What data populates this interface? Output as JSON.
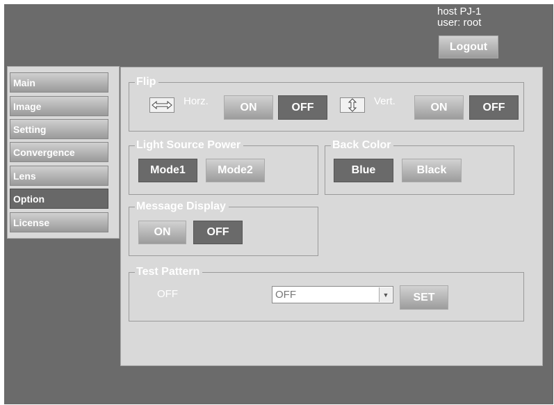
{
  "header": {
    "host": "host PJ-1",
    "user": "user: root",
    "logout_label": "Logout"
  },
  "sidebar": {
    "items": [
      {
        "label": "Main",
        "active": false
      },
      {
        "label": "Image",
        "active": false
      },
      {
        "label": "Setting",
        "active": false
      },
      {
        "label": "Convergence",
        "active": false
      },
      {
        "label": "Lens",
        "active": false
      },
      {
        "label": "Option",
        "active": true
      },
      {
        "label": "License",
        "active": false
      }
    ]
  },
  "flip": {
    "title": "Flip",
    "horz_label": "Horz.",
    "horz_on": "ON",
    "horz_off": "OFF",
    "horz_selected": "OFF",
    "vert_label": "Vert.",
    "vert_on": "ON",
    "vert_off": "OFF",
    "vert_selected": "OFF"
  },
  "light_source": {
    "title": "Light Source  Power",
    "mode1": "Mode1",
    "mode2": "Mode2",
    "selected": "Mode1"
  },
  "back_color": {
    "title": "Back Color",
    "blue": "Blue",
    "black": "Black",
    "selected": "Blue"
  },
  "message_display": {
    "title": "Message Display",
    "on": "ON",
    "off": "OFF",
    "selected": "OFF"
  },
  "test_pattern": {
    "title": "Test Pattern",
    "current": "OFF",
    "select_value": "OFF",
    "set_label": "SET"
  }
}
